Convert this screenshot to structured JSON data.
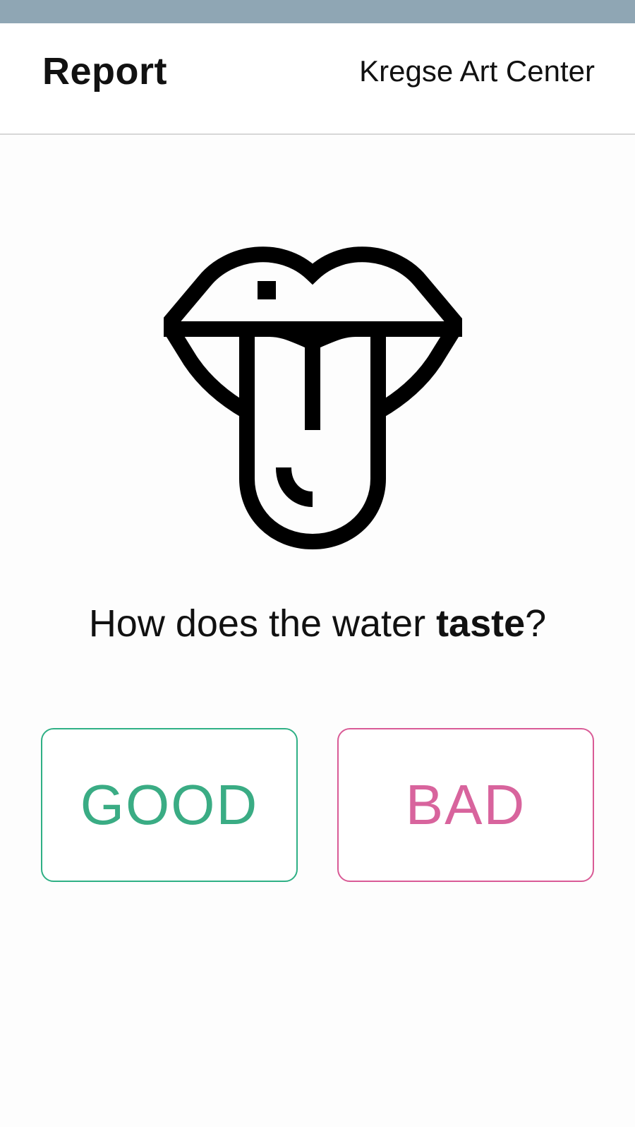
{
  "header": {
    "title": "Report",
    "location": "Kregse Art Center"
  },
  "illustration": {
    "icon": "tongue-out-mouth-icon"
  },
  "question": {
    "prefix": "How does the water ",
    "emphasis": "taste",
    "suffix": "?"
  },
  "choices": {
    "good_label": "GOOD",
    "bad_label": "BAD"
  },
  "colors": {
    "status_bar": "#8fa6b4",
    "good": "#3aac84",
    "bad": "#d8649d"
  }
}
